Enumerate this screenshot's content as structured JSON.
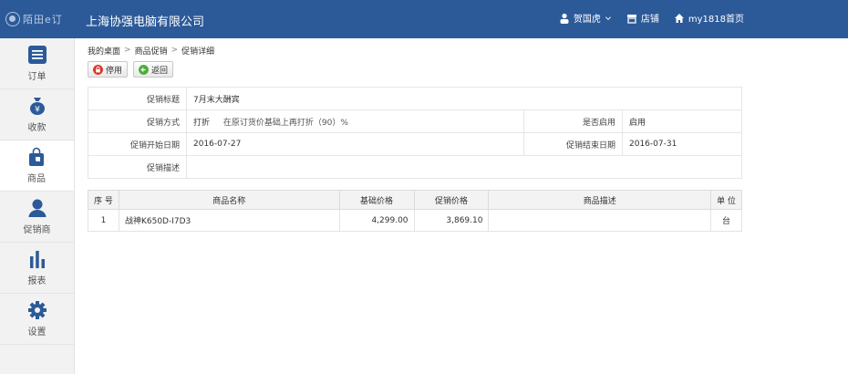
{
  "header": {
    "logo_text": "陌田e订",
    "company": "上海协强电脑有限公司",
    "user": "贺国虎",
    "store": "店铺",
    "home": "my1818首页"
  },
  "sidebar": {
    "items": [
      {
        "label": "订单",
        "icon": "order-list-icon"
      },
      {
        "label": "收款",
        "icon": "money-bag-icon"
      },
      {
        "label": "商品",
        "icon": "shopping-bag-icon"
      },
      {
        "label": "促销商",
        "icon": "user-icon"
      },
      {
        "label": "报表",
        "icon": "bar-chart-icon"
      },
      {
        "label": "设置",
        "icon": "gear-icon"
      }
    ],
    "active_index": 2
  },
  "breadcrumb": [
    "我的桌面",
    "商品促销",
    "促销详细"
  ],
  "actions": {
    "disable": "停用",
    "back": "返回"
  },
  "promo": {
    "title_label": "促销标题",
    "title": "7月末大酬宾",
    "method_label": "促销方式",
    "method": "打折",
    "method_detail": "在原订货价基础上再打折（90）%",
    "enabled_label": "是否启用",
    "enabled": "启用",
    "start_label": "促销开始日期",
    "start": "2016-07-27",
    "end_label": "促销结束日期",
    "end": "2016-07-31",
    "desc_label": "促销描述",
    "desc": ""
  },
  "goods": {
    "headers": [
      "序 号",
      "商品名称",
      "基础价格",
      "促销价格",
      "商品描述",
      "单 位"
    ],
    "rows": [
      {
        "no": "1",
        "name": "战神K650D-I7D3",
        "base": "4,299.00",
        "promo": "3,869.10",
        "desc": "",
        "unit": "台"
      }
    ]
  },
  "colors": {
    "topbar": "#2c5a99",
    "sidebar": "#f2f2f2",
    "icon_blue": "#2c5a99",
    "stop_red": "#d9342b",
    "back_green": "#4cae3c"
  }
}
